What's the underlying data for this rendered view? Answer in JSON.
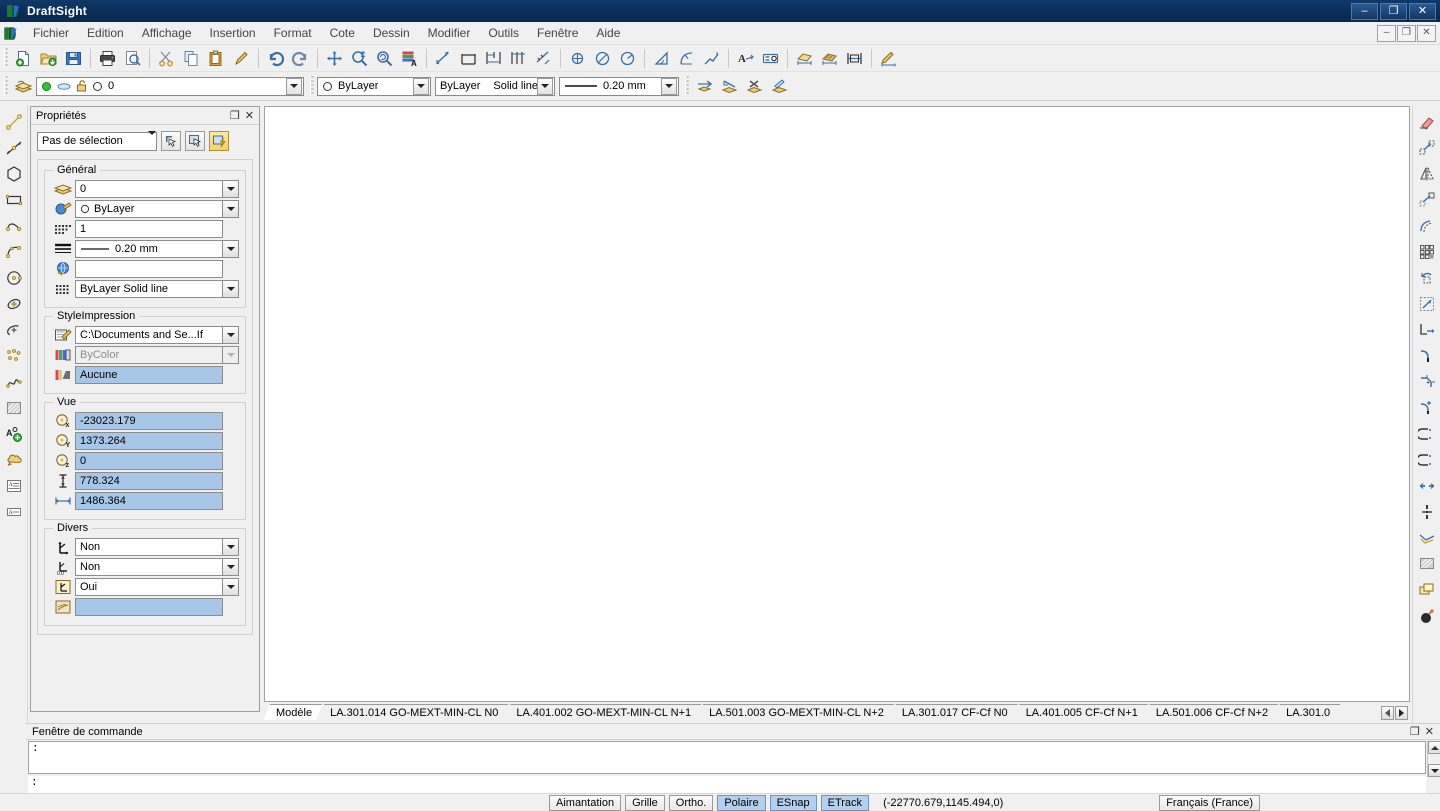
{
  "window": {
    "title": "DraftSight",
    "app_icon": "draftsight-logo-icon",
    "minimize_label": "–",
    "maximize_label": "❐",
    "close_label": "✕",
    "doc_minimize_label": "–",
    "doc_restore_label": "❐",
    "doc_close_label": "✕"
  },
  "menubar": {
    "items": [
      {
        "label": "Fichier",
        "name": "menu-fichier"
      },
      {
        "label": "Edition",
        "name": "menu-edition"
      },
      {
        "label": "Affichage",
        "name": "menu-affichage"
      },
      {
        "label": "Insertion",
        "name": "menu-insertion"
      },
      {
        "label": "Format",
        "name": "menu-format"
      },
      {
        "label": "Cote",
        "name": "menu-cote"
      },
      {
        "label": "Dessin",
        "name": "menu-dessin"
      },
      {
        "label": "Modifier",
        "name": "menu-modifier"
      },
      {
        "label": "Outils",
        "name": "menu-outils"
      },
      {
        "label": "Fenêtre",
        "name": "menu-fenetre"
      },
      {
        "label": "Aide",
        "name": "menu-aide"
      }
    ]
  },
  "toolbar_standard": {
    "buttons": [
      {
        "icon": "new-document-icon"
      },
      {
        "icon": "open-folder-icon"
      },
      {
        "icon": "save-icon"
      },
      {
        "sep": true
      },
      {
        "icon": "print-icon"
      },
      {
        "icon": "print-preview-icon"
      },
      {
        "sep": true
      },
      {
        "icon": "cut-scissors-icon"
      },
      {
        "icon": "copy-icon"
      },
      {
        "icon": "paste-icon"
      },
      {
        "icon": "format-painter-icon"
      },
      {
        "sep": true
      },
      {
        "icon": "undo-icon"
      },
      {
        "icon": "redo-icon"
      },
      {
        "sep": true
      },
      {
        "icon": "pan-icon"
      },
      {
        "icon": "zoom-window-icon"
      },
      {
        "icon": "zoom-previous-icon"
      },
      {
        "icon": "property-table-icon"
      },
      {
        "sep": true
      },
      {
        "icon": "dimension-linear-smart-icon"
      },
      {
        "icon": "dimension-horizontal-icon"
      },
      {
        "icon": "dimension-baseline-icon"
      },
      {
        "icon": "dimension-continue-icon"
      },
      {
        "icon": "dimension-aligned-icon"
      },
      {
        "sep": true
      },
      {
        "icon": "dimension-center-mark-icon"
      },
      {
        "icon": "dimension-diameter-icon"
      },
      {
        "icon": "dimension-radius-icon"
      },
      {
        "sep": true
      },
      {
        "icon": "dimension-angular-icon"
      },
      {
        "icon": "dimension-arc-length-icon"
      },
      {
        "icon": "dimension-leader-icon"
      },
      {
        "sep": true
      },
      {
        "icon": "text-annotation-icon"
      },
      {
        "icon": "dimension-style-icon"
      },
      {
        "sep": true
      },
      {
        "icon": "hatch-dimension-icon"
      },
      {
        "icon": "hatch-edit-icon"
      },
      {
        "icon": "dimension-spacing-icon"
      },
      {
        "sep": true
      },
      {
        "icon": "dimension-edit-icon"
      }
    ]
  },
  "toolbar_properties": {
    "layer_icon": "layer-manager-icon",
    "layer": {
      "state_icons": [
        "lightbulb-on-icon",
        "freeze-icon",
        "lock-open-icon",
        "color-swatch-icon"
      ],
      "value": "0"
    },
    "color": {
      "value": "ByLayer",
      "swatch_icon": "color-circle-icon"
    },
    "linestyle": {
      "value_left": "ByLayer",
      "value_right": "Solid line"
    },
    "lineweight": {
      "value": "0.20 mm"
    },
    "right_buttons": [
      {
        "icon": "layer-previous-icon"
      },
      {
        "icon": "layer-state-icon"
      },
      {
        "icon": "layer-delete-icon"
      },
      {
        "icon": "layer-edit-icon"
      }
    ]
  },
  "left_toolstrip": {
    "buttons": [
      {
        "icon": "line-icon"
      },
      {
        "icon": "infinite-line-icon"
      },
      {
        "icon": "polygon-icon"
      },
      {
        "icon": "rectangle-icon"
      },
      {
        "icon": "polyline-icon"
      },
      {
        "icon": "arc-icon"
      },
      {
        "icon": "circle-icon"
      },
      {
        "icon": "ellipse-icon"
      },
      {
        "icon": "ellipse-arc-icon"
      },
      {
        "icon": "point-cloud-icon"
      },
      {
        "icon": "spline-icon"
      },
      {
        "icon": "hatch-icon"
      },
      {
        "icon": "block-insert-icon"
      },
      {
        "icon": "cloud-revision-icon"
      },
      {
        "icon": "note-multiline-text-icon"
      },
      {
        "icon": "simple-note-icon"
      }
    ]
  },
  "right_toolstrip": {
    "buttons": [
      {
        "icon": "eraser-delete-icon"
      },
      {
        "icon": "copy-entity-icon"
      },
      {
        "icon": "mirror-icon"
      },
      {
        "icon": "move-icon"
      },
      {
        "icon": "offset-icon"
      },
      {
        "icon": "pattern-array-icon"
      },
      {
        "icon": "rotate-icon"
      },
      {
        "icon": "scale-icon"
      },
      {
        "icon": "stretch-icon"
      },
      {
        "icon": "fillet-icon"
      },
      {
        "icon": "chamfer-icon"
      },
      {
        "icon": "trim-icon"
      },
      {
        "icon": "extend-icon"
      },
      {
        "icon": "split-icon"
      },
      {
        "icon": "split-at-point-icon"
      },
      {
        "icon": "explode-icon"
      },
      {
        "icon": "edit-hatch-icon"
      },
      {
        "icon": "edit-block-icon"
      },
      {
        "icon": "edit-polyline-icon"
      },
      {
        "icon": "purge-bomb-icon"
      }
    ]
  },
  "properties_panel": {
    "title": "Propriétés",
    "restore_glyph": "❐",
    "close_glyph": "✕",
    "selection": {
      "value": "Pas de sélection",
      "buttons": [
        {
          "icon": "quick-select-icon",
          "active": false
        },
        {
          "icon": "select-all-icon",
          "active": false
        },
        {
          "icon": "toggle-value-icon",
          "active": true
        }
      ]
    },
    "groups": [
      {
        "label": "Général",
        "name": "group-general",
        "rows": [
          {
            "icon": "layer-icon",
            "value": "0",
            "dropdown": true,
            "style": "white",
            "name": "property-layer"
          },
          {
            "icon": "color-icon",
            "value": "ByLayer",
            "dropdown": true,
            "style": "white",
            "swatch": true,
            "name": "property-color"
          },
          {
            "icon": "linestyle-scale-icon",
            "value": "1",
            "dropdown": false,
            "style": "white",
            "name": "property-linestyle-scale"
          },
          {
            "icon": "lineweight-icon",
            "value": "0.20 mm",
            "dropdown": true,
            "style": "white",
            "dash": true,
            "name": "property-lineweight"
          },
          {
            "icon": "hyperlink-icon",
            "value": "",
            "dropdown": false,
            "style": "white",
            "name": "property-hyperlink"
          },
          {
            "icon": "linestyle-icon",
            "value": "ByLayer      Solid line",
            "dropdown": true,
            "style": "white",
            "name": "property-linestyle"
          }
        ]
      },
      {
        "label": "StyleImpression",
        "name": "group-styleimpression",
        "rows": [
          {
            "icon": "print-style-table-icon",
            "value": "C:\\Documents and Se...If",
            "dropdown": true,
            "style": "white",
            "name": "property-print-style-table"
          },
          {
            "icon": "print-style-color-icon",
            "value": "ByColor",
            "dropdown": true,
            "style": "gray",
            "disabled": true,
            "name": "property-print-style-color"
          },
          {
            "icon": "print-style-table-attached-icon",
            "value": "Aucune",
            "dropdown": false,
            "style": "blue",
            "name": "property-print-style-attached"
          }
        ]
      },
      {
        "label": "Vue",
        "name": "group-vue",
        "rows": [
          {
            "icon": "view-center-x-icon",
            "value": "-23023.179",
            "dropdown": false,
            "style": "blue",
            "name": "property-view-center-x"
          },
          {
            "icon": "view-center-y-icon",
            "value": "1373.264",
            "dropdown": false,
            "style": "blue",
            "name": "property-view-center-y"
          },
          {
            "icon": "view-center-z-icon",
            "value": "0",
            "dropdown": false,
            "style": "blue",
            "name": "property-view-center-z"
          },
          {
            "icon": "view-height-icon",
            "value": "778.324",
            "dropdown": false,
            "style": "blue",
            "name": "property-view-height"
          },
          {
            "icon": "view-width-icon",
            "value": "1486.364",
            "dropdown": false,
            "style": "blue",
            "name": "property-view-width"
          }
        ]
      },
      {
        "label": "Divers",
        "name": "group-divers",
        "rows": [
          {
            "icon": "ccs-icon",
            "value": "Non",
            "dropdown": true,
            "style": "white",
            "name": "property-ccs"
          },
          {
            "icon": "ccs-origin-icon",
            "value": "Non",
            "dropdown": true,
            "style": "white",
            "name": "property-ccs-origin"
          },
          {
            "icon": "ccs-display-icon",
            "value": "Oui",
            "dropdown": true,
            "style": "white",
            "name": "property-ccs-display"
          },
          {
            "icon": "visual-style-icon",
            "value": "",
            "dropdown": false,
            "style": "blue",
            "name": "property-visual-style"
          }
        ]
      }
    ]
  },
  "sheet_tabs": {
    "tabs": [
      {
        "label": "Modèle",
        "active": true
      },
      {
        "label": "LA.301.014  GO-MEXT-MIN-CL  N0",
        "active": false
      },
      {
        "label": "LA.401.002  GO-MEXT-MIN-CL  N+1",
        "active": false
      },
      {
        "label": "LA.501.003  GO-MEXT-MIN-CL  N+2",
        "active": false
      },
      {
        "label": "LA.301.017  CF-Cf  N0",
        "active": false
      },
      {
        "label": "LA.401.005  CF-Cf  N+1",
        "active": false
      },
      {
        "label": "LA.501.006  CF-Cf  N+2",
        "active": false
      },
      {
        "label": "LA.301.0",
        "active": false
      }
    ],
    "scroll_prev": "◄",
    "scroll_next": "►"
  },
  "command_window": {
    "title": "Fenêtre de commande",
    "restore_glyph": "❐",
    "close_glyph": "✕",
    "history": ":",
    "prompt": ":",
    "input_value": ""
  },
  "statusbar": {
    "toggles": [
      {
        "label": "Aimantation",
        "on": false,
        "name": "status-toggle-snap"
      },
      {
        "label": "Grille",
        "on": false,
        "name": "status-toggle-grid"
      },
      {
        "label": "Ortho.",
        "on": false,
        "name": "status-toggle-ortho"
      },
      {
        "label": "Polaire",
        "on": true,
        "name": "status-toggle-polar"
      },
      {
        "label": "ESnap",
        "on": true,
        "name": "status-toggle-esnap"
      },
      {
        "label": "ETrack",
        "on": true,
        "name": "status-toggle-etrack"
      }
    ],
    "coordinates": "(-22770.679,1145.494,0)",
    "language": "Français (France)"
  },
  "colors": {
    "title_bar": "#0b2e57",
    "accent_blue": "#a8c6e8",
    "toggle_on": "#b3d0ee",
    "canvas": "#ffffff",
    "chrome": "#f0f0f0"
  }
}
